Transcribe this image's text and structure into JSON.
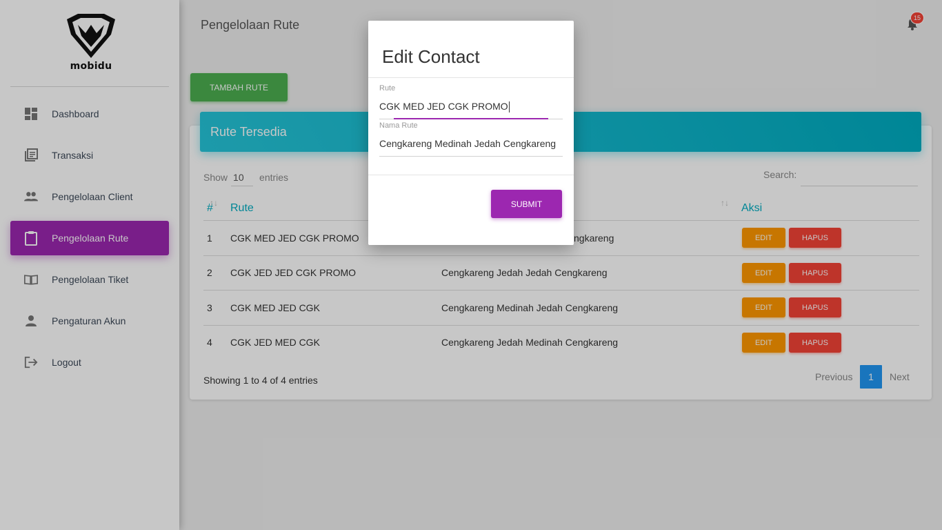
{
  "brand": {
    "name": "mobidu"
  },
  "sidebar": {
    "items": [
      {
        "label": "Dashboard",
        "icon": "dashboard-icon"
      },
      {
        "label": "Transaksi",
        "icon": "list-icon"
      },
      {
        "label": "Pengelolaan Client",
        "icon": "people-icon"
      },
      {
        "label": "Pengelolaan Rute",
        "icon": "clipboard-icon",
        "active": true
      },
      {
        "label": "Pengelolaan Tiket",
        "icon": "book-icon"
      },
      {
        "label": "Pengaturan Akun",
        "icon": "person-icon"
      },
      {
        "label": "Logout",
        "icon": "logout-icon"
      }
    ]
  },
  "header": {
    "title": "Pengelolaan Rute",
    "notification_count": "15"
  },
  "actions": {
    "add_label": "TAMBAH RUTE"
  },
  "card": {
    "title": "Rute Tersedia"
  },
  "table": {
    "show_label": "Show",
    "entries_value": "10",
    "entries_label": "entries",
    "search_label": "Search:",
    "columns": [
      "#",
      "Rute",
      "Aksi"
    ],
    "rows": [
      {
        "no": "1",
        "rute": "CGK MED JED CGK PROMO",
        "nama": "Cengkareng Medinah Jedah Cengkareng"
      },
      {
        "no": "2",
        "rute": "CGK JED JED CGK PROMO",
        "nama": "Cengkareng Jedah Jedah Cengkareng"
      },
      {
        "no": "3",
        "rute": "CGK MED JED CGK",
        "nama": "Cengkareng Medinah Jedah Cengkareng"
      },
      {
        "no": "4",
        "rute": "CGK JED MED CGK",
        "nama": "Cengkareng Jedah Medinah Cengkareng"
      }
    ],
    "row0_nama_visible": "ngkareng",
    "edit_label": "EDIT",
    "delete_label": "HAPUS",
    "showing_text": "Showing 1 to 4 of 4 entries",
    "prev_label": "Previous",
    "current_page": "1",
    "next_label": "Next"
  },
  "modal": {
    "title": "Edit Contact",
    "rute_label": "Rute",
    "rute_value": "CGK MED JED CGK PROMO",
    "nama_label": "Nama Rute",
    "nama_value": "Cengkareng Medinah Jedah Cengkareng",
    "submit_label": "SUBMIT"
  },
  "colors": {
    "accent": "#9c27b0",
    "success": "#4caf50",
    "info": "#00acc1",
    "warning": "#ff9800",
    "danger": "#f44336",
    "primary": "#2196f3"
  }
}
